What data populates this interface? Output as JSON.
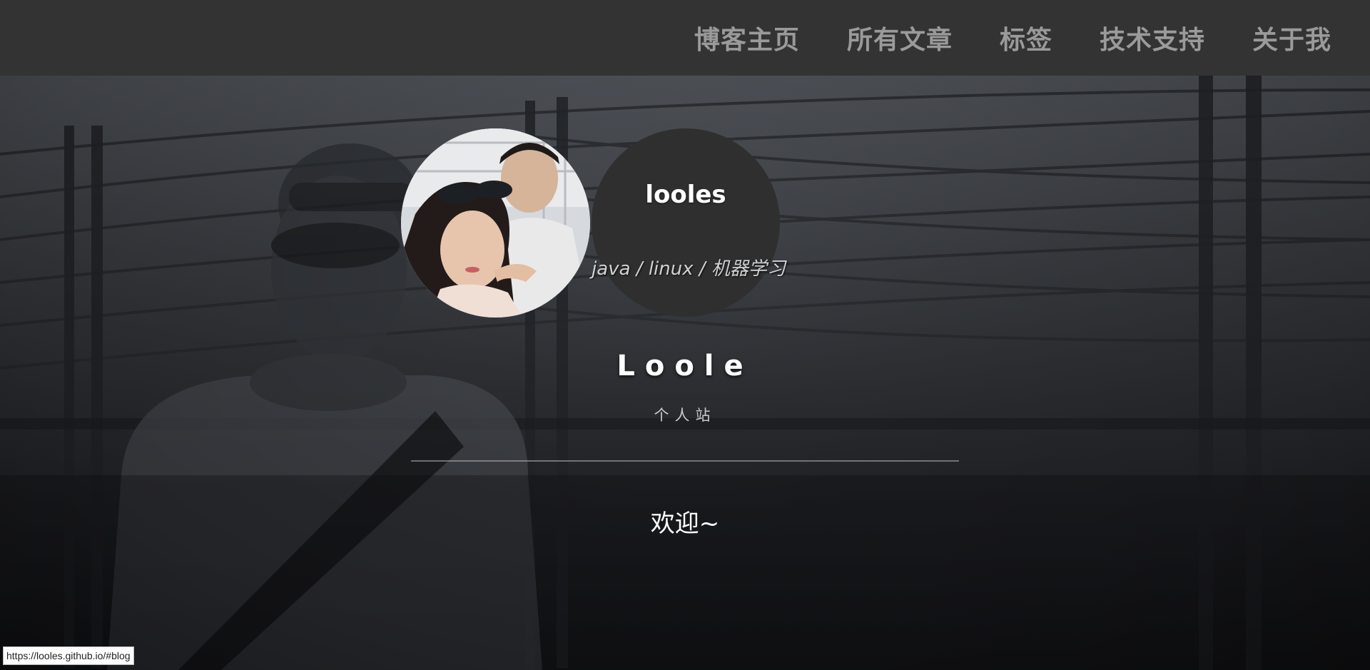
{
  "nav": {
    "items": [
      {
        "label": "博客主页"
      },
      {
        "label": "所有文章"
      },
      {
        "label": "标签"
      },
      {
        "label": "技术支持"
      },
      {
        "label": "关于我"
      }
    ]
  },
  "profile": {
    "username": "looles",
    "tags": "java / linux / 机器学习"
  },
  "site": {
    "title": "Loole",
    "subtitle": "个人站",
    "welcome": "欢迎~"
  },
  "status_bar": {
    "url": "https://looles.github.io/#blog"
  },
  "colors": {
    "navbar_bg": "#333333",
    "nav_text": "#9a9a9a",
    "avatar_dark": "#2f2f2f"
  }
}
